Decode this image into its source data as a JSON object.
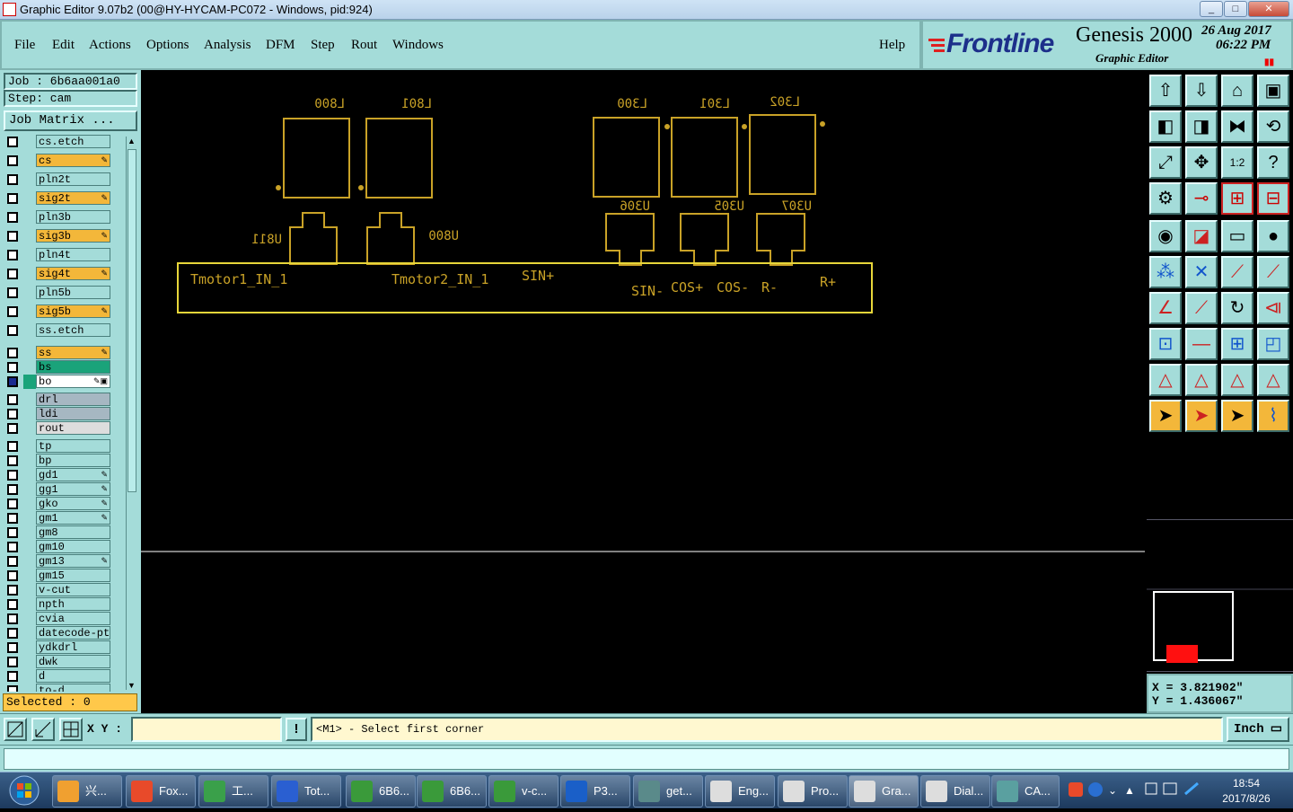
{
  "window": {
    "title": "Graphic Editor 9.07b2 (00@HY-HYCAM-PC072 - Windows, pid:924)",
    "buttons": [
      "_",
      "□",
      "✕"
    ]
  },
  "menubar": {
    "items": [
      "File",
      "Edit",
      "Actions",
      "Options",
      "Analysis",
      "DFM",
      "Step",
      "Rout",
      "Windows"
    ],
    "help": "Help"
  },
  "brand": {
    "logo": "Frontline",
    "product": "Genesis 2000",
    "subtitle": "Graphic Editor",
    "date": "26 Aug 2017",
    "time": "06:22 PM"
  },
  "job": {
    "job_line": "Job : 6b6aa001a0",
    "step_line": "Step: cam",
    "matrix_button": "Job Matrix ..."
  },
  "layers": [
    {
      "name": "cs.etch",
      "color": "#a4dcd9",
      "mark": ""
    },
    {
      "name": "cs",
      "color": "#f3b73a",
      "mark": "✎"
    },
    {
      "name": "pln2t",
      "color": "#a4dcd9",
      "mark": ""
    },
    {
      "name": "sig2t",
      "color": "#f3b73a",
      "mark": "✎"
    },
    {
      "name": "pln3b",
      "color": "#a4dcd9",
      "mark": ""
    },
    {
      "name": "sig3b",
      "color": "#f3b73a",
      "mark": "✎"
    },
    {
      "name": "pln4t",
      "color": "#a4dcd9",
      "mark": ""
    },
    {
      "name": "sig4t",
      "color": "#f3b73a",
      "mark": "✎"
    },
    {
      "name": "pln5b",
      "color": "#a4dcd9",
      "mark": ""
    },
    {
      "name": "sig5b",
      "color": "#f3b73a",
      "mark": "✎"
    },
    {
      "name": "ss.etch",
      "color": "#a4dcd9",
      "mark": ""
    },
    {
      "name": "ss",
      "color": "#f3b73a",
      "mark": "✎"
    },
    {
      "name": "bs",
      "color": "#1aa37a",
      "mark": ""
    },
    {
      "name": "bo",
      "color": "#ffffff",
      "mark": "✎▣"
    },
    {
      "name": "drl",
      "color": "#a6b7c2",
      "mark": ""
    },
    {
      "name": "ldi",
      "color": "#a6b7c2",
      "mark": ""
    },
    {
      "name": "rout",
      "color": "#dddddd",
      "mark": ""
    },
    {
      "name": "tp",
      "color": "#a4dcd9",
      "mark": ""
    },
    {
      "name": "bp",
      "color": "#a4dcd9",
      "mark": ""
    },
    {
      "name": "gd1",
      "color": "#a4dcd9",
      "mark": "✎"
    },
    {
      "name": "gg1",
      "color": "#a4dcd9",
      "mark": "✎"
    },
    {
      "name": "gko",
      "color": "#a4dcd9",
      "mark": "✎"
    },
    {
      "name": "gm1",
      "color": "#a4dcd9",
      "mark": "✎"
    },
    {
      "name": "gm8",
      "color": "#a4dcd9",
      "mark": ""
    },
    {
      "name": "gm10",
      "color": "#a4dcd9",
      "mark": ""
    },
    {
      "name": "gm13",
      "color": "#a4dcd9",
      "mark": "✎"
    },
    {
      "name": "gm15",
      "color": "#a4dcd9",
      "mark": ""
    },
    {
      "name": "v-cut",
      "color": "#a4dcd9",
      "mark": ""
    },
    {
      "name": "npth",
      "color": "#a4dcd9",
      "mark": ""
    },
    {
      "name": "cvia",
      "color": "#a4dcd9",
      "mark": ""
    },
    {
      "name": "datecode-pt",
      "color": "#a4dcd9",
      "mark": ""
    },
    {
      "name": "ydkdrl",
      "color": "#a4dcd9",
      "mark": ""
    },
    {
      "name": "dwk",
      "color": "#a4dcd9",
      "mark": ""
    },
    {
      "name": "d",
      "color": "#a4dcd9",
      "mark": ""
    },
    {
      "name": "to-d",
      "color": "#a4dcd9",
      "mark": ""
    }
  ],
  "selected": "Selected : 0",
  "canvas": {
    "component_labels": [
      "L800",
      "L801",
      "L300",
      "L301",
      "L302",
      "U306",
      "U305",
      "U307",
      "U811",
      "U800"
    ],
    "net_labels": [
      "Tmotor1_IN_1",
      "Tmotor2_IN_1",
      "SIN+",
      "SIN-",
      "COS+",
      "COS-",
      "R-",
      "R+"
    ]
  },
  "coords": {
    "x": "X = 3.821902\"",
    "y": "Y = 1.436067\""
  },
  "bottombar": {
    "xy_label": "X Y :",
    "xy_value": "",
    "message": "<M1> - Select first corner",
    "unit": "Inch"
  },
  "taskbar": {
    "items": [
      "兴...",
      "Fox...",
      "工...",
      "Tot...",
      "6B6...",
      "6B6...",
      "v-c...",
      "P3...",
      "get...",
      "Eng...",
      "Pro...",
      "Gra...",
      "Dial...",
      "CA..."
    ],
    "time": "18:54",
    "date": "2017/8/26"
  }
}
